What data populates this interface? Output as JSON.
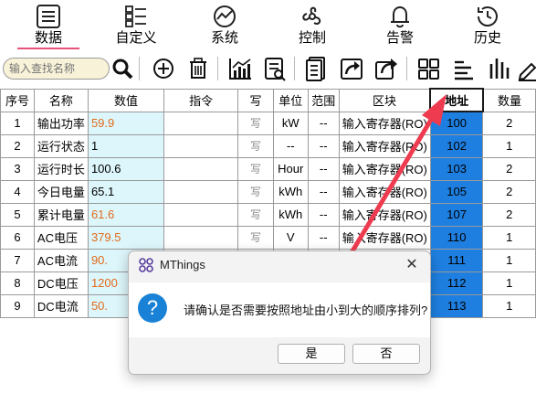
{
  "nav": [
    {
      "label": "数据",
      "icon": "list-doc-icon",
      "active": true
    },
    {
      "label": "自定义",
      "icon": "custom-list-icon",
      "active": false
    },
    {
      "label": "系统",
      "icon": "system-gauge-icon",
      "active": false
    },
    {
      "label": "控制",
      "icon": "control-fan-icon",
      "active": false
    },
    {
      "label": "告警",
      "icon": "alarm-bell-icon",
      "active": false
    },
    {
      "label": "历史",
      "icon": "history-clock-icon",
      "active": false
    }
  ],
  "toolbar": {
    "search_placeholder": "输入查找名称",
    "icons": [
      "search-icon",
      "add-icon",
      "delete-icon",
      "chart-icon",
      "report-icon",
      "document-icon",
      "export-icon",
      "share-icon",
      "grid-icon",
      "align-left-icon",
      "bars-vertical-icon",
      "edit-icon"
    ]
  },
  "table": {
    "headers": [
      "序号",
      "名称",
      "数值",
      "指令",
      "写",
      "单位",
      "范围",
      "区块",
      "地址",
      "数量"
    ],
    "rows": [
      {
        "no": "1",
        "name": "输出功率",
        "value": "59.9",
        "value_color": "orange",
        "cmd": "",
        "write": "写",
        "unit": "kW",
        "range": "--",
        "block": "输入寄存器(RO)",
        "addr": "100",
        "count": "2"
      },
      {
        "no": "2",
        "name": "运行状态",
        "value": "1",
        "value_color": "black",
        "cmd": "",
        "write": "写",
        "unit": "--",
        "range": "--",
        "block": "输入寄存器(RO)",
        "addr": "102",
        "count": "1"
      },
      {
        "no": "3",
        "name": "运行时长",
        "value": "100.6",
        "value_color": "black",
        "cmd": "",
        "write": "写",
        "unit": "Hour",
        "range": "--",
        "block": "输入寄存器(RO)",
        "addr": "103",
        "count": "2"
      },
      {
        "no": "4",
        "name": "今日电量",
        "value": "65.1",
        "value_color": "black",
        "cmd": "",
        "write": "写",
        "unit": "kWh",
        "range": "--",
        "block": "输入寄存器(RO)",
        "addr": "105",
        "count": "2"
      },
      {
        "no": "5",
        "name": "累计电量",
        "value": "61.6",
        "value_color": "orange",
        "cmd": "",
        "write": "写",
        "unit": "kWh",
        "range": "--",
        "block": "输入寄存器(RO)",
        "addr": "107",
        "count": "2"
      },
      {
        "no": "6",
        "name": "AC电压",
        "value": "379.5",
        "value_color": "orange",
        "cmd": "",
        "write": "写",
        "unit": "V",
        "range": "--",
        "block": "输入寄存器(RO)",
        "addr": "110",
        "count": "1"
      },
      {
        "no": "7",
        "name": "AC电流",
        "value": "90.",
        "value_color": "orange",
        "cmd": "",
        "write": "",
        "unit": "",
        "range": "",
        "block": "",
        "addr": "111",
        "count": "1"
      },
      {
        "no": "8",
        "name": "DC电压",
        "value": "1200",
        "value_color": "orange",
        "cmd": "",
        "write": "",
        "unit": "",
        "range": "",
        "block": "",
        "addr": "112",
        "count": "1"
      },
      {
        "no": "9",
        "name": "DC电流",
        "value": "50.",
        "value_color": "orange",
        "cmd": "",
        "write": "",
        "unit": "",
        "range": "",
        "block": "",
        "addr": "113",
        "count": "1"
      }
    ]
  },
  "dialog": {
    "title": "MThings",
    "message": "请确认是否需要按照地址由小到大的顺序排列?",
    "yes_label": "是",
    "no_label": "否",
    "close_glyph": "✕"
  },
  "colors": {
    "accent_underline": "#e5527a",
    "value_bg": "#ddf6fb",
    "address_bg": "#1e7fe0",
    "orange_text": "#e06a1b",
    "arrow": "#ee3b4f"
  }
}
